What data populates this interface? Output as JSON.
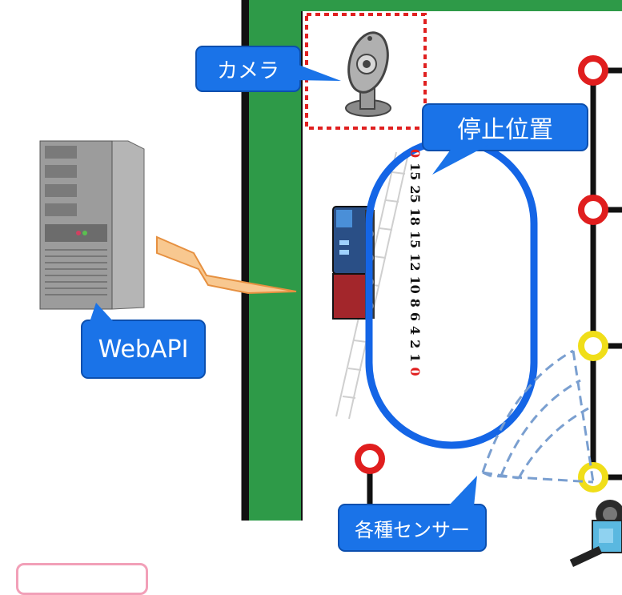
{
  "labels": {
    "camera": "カメラ",
    "stop_position": "停止位置",
    "webapi": "WebAPI",
    "sensors": "各種センサー"
  },
  "stop_numbers": [
    "0",
    "15",
    "25",
    "18",
    "15",
    "12",
    "10",
    "8",
    "6",
    "4",
    "2",
    "1",
    "0"
  ],
  "colors": {
    "track_green": "#2e9a48",
    "callout_blue": "#1a73e8",
    "oval_blue": "#1465e6",
    "stop_red": "#e01e1e",
    "stop_yellow": "#f0de19",
    "camera_frame": "#e02020",
    "sensor_dashes": "#7a9fd0"
  },
  "icons": [
    "webcam-icon",
    "server-icon",
    "train-icon",
    "robot-icon",
    "lightning-icon",
    "ladder-icon"
  ]
}
